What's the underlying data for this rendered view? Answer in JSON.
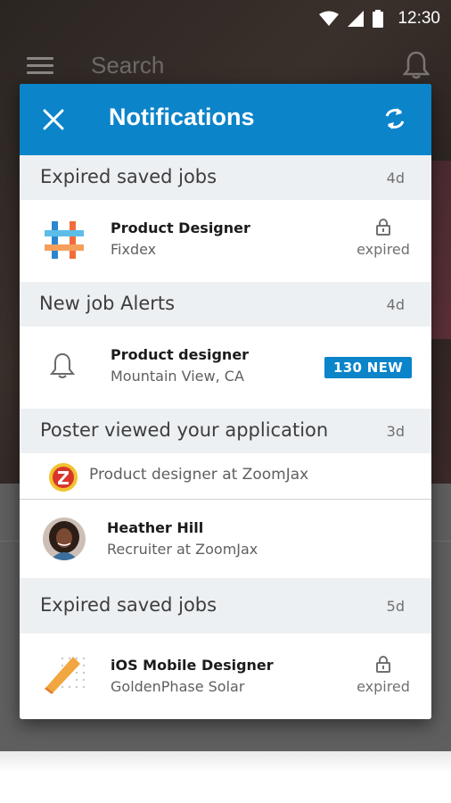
{
  "status_bar": {
    "time": "12:30"
  },
  "background_app": {
    "search_placeholder": "Search"
  },
  "modal": {
    "title": "Notifications",
    "colors": {
      "header": "#0b84c9",
      "badge": "#0b84c9"
    },
    "sections": [
      {
        "title": "Expired saved jobs",
        "age": "4d",
        "item": {
          "title": "Product Designer",
          "subtitle": "Fixdex",
          "status": "expired",
          "icon": "fixdex-logo-icon"
        }
      },
      {
        "title": "New job Alerts",
        "age": "4d",
        "item": {
          "title": "Product designer",
          "subtitle": "Mountain View, CA",
          "badge": "130 NEW",
          "icon": "bell-icon"
        }
      },
      {
        "title": "Poster viewed your application",
        "age": "3d",
        "company_line": {
          "text": "Product designer at ZoomJax",
          "icon": "zoomjax-logo-icon"
        },
        "item": {
          "title": "Heather Hill",
          "subtitle": "Recruiter at ZoomJax",
          "icon": "avatar"
        }
      },
      {
        "title": "Expired saved jobs",
        "age": "5d",
        "item": {
          "title": "iOS Mobile Designer",
          "subtitle": "GoldenPhase Solar",
          "status": "expired",
          "icon": "goldenphase-logo-icon"
        }
      }
    ]
  }
}
